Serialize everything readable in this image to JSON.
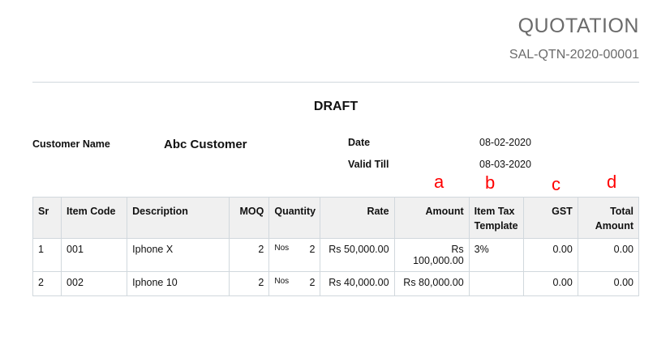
{
  "header": {
    "title": "QUOTATION",
    "number": "SAL-QTN-2020-00001"
  },
  "status": "DRAFT",
  "info": {
    "customer_label": "Customer Name",
    "customer_value": "Abc Customer",
    "date_label": "Date",
    "date_value": "08-02-2020",
    "valid_till_label": "Valid Till",
    "valid_till_value": "08-03-2020"
  },
  "markers": [
    "a",
    "b",
    "c",
    "d"
  ],
  "table": {
    "headers": {
      "sr": "Sr",
      "item_code": "Item Code",
      "description": "Description",
      "moq": "MOQ",
      "quantity": "Quantity",
      "rate": "Rate",
      "amount": "Amount",
      "item_tax_template": "Item Tax Template",
      "gst": "GST",
      "total_amount": "Total Amount"
    },
    "rows": [
      {
        "sr": "1",
        "item_code": "001",
        "description": "Iphone X",
        "moq": "2",
        "uom": "Nos",
        "qty": "2",
        "rate": "Rs 50,000.00",
        "amount": "Rs 100,000.00",
        "item_tax_template": "3%",
        "gst": "0.00",
        "total_amount": "0.00"
      },
      {
        "sr": "2",
        "item_code": "002",
        "description": "Iphone 10",
        "moq": "2",
        "uom": "Nos",
        "qty": "2",
        "rate": "Rs 40,000.00",
        "amount": "Rs 80,000.00",
        "item_tax_template": "",
        "gst": "0.00",
        "total_amount": "0.00"
      }
    ]
  }
}
